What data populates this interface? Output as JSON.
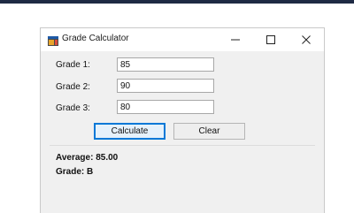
{
  "window": {
    "title": "Grade Calculator",
    "icon": "grade-calculator-app-icon",
    "controls": {
      "minimize": "minimize-icon",
      "maximize": "maximize-icon",
      "close": "close-icon"
    }
  },
  "form": {
    "grade1": {
      "label": "Grade 1:",
      "value": "85"
    },
    "grade2": {
      "label": "Grade 2:",
      "value": "90"
    },
    "grade3": {
      "label": "Grade 3:",
      "value": "80"
    }
  },
  "buttons": {
    "calculate": "Calculate",
    "clear": "Clear"
  },
  "results": {
    "average": "Average: 85.00",
    "grade": "Grade: B"
  },
  "colors": {
    "topbar": "#1f2a44",
    "window_bg": "#f0f0f0",
    "titlebar_bg": "#ffffff",
    "accent_focus": "#0078d7"
  }
}
